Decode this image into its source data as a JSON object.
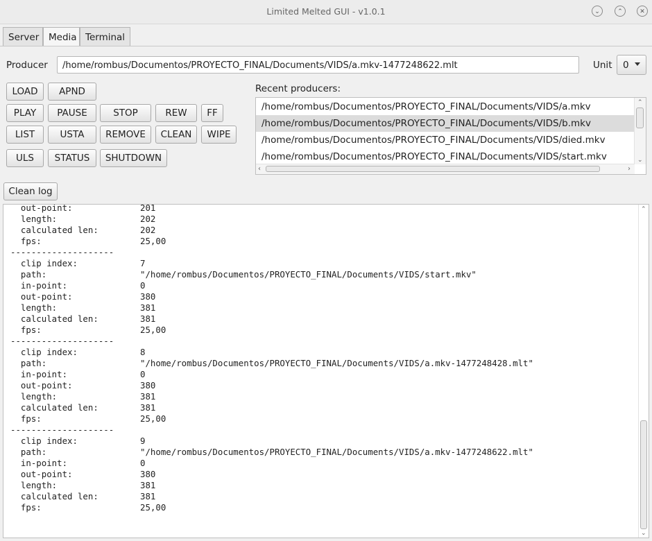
{
  "window": {
    "title": "Limited Melted GUI - v1.0.1"
  },
  "tabs": [
    {
      "label": "Server"
    },
    {
      "label": "Media"
    },
    {
      "label": "Terminal"
    }
  ],
  "producer": {
    "label": "Producer",
    "value": "/home/rombus/Documentos/PROYECTO_FINAL/Documents/VIDS/a.mkv-1477248622.mlt"
  },
  "unit": {
    "label": "Unit",
    "value": "0"
  },
  "buttons": {
    "load": "LOAD",
    "apnd": "APND",
    "play": "PLAY",
    "pause": "PAUSE",
    "stop": "STOP",
    "rew": "REW",
    "ff": "FF",
    "list": "LIST",
    "usta": "USTA",
    "remove": "REMOVE",
    "clean": "CLEAN",
    "wipe": "WIPE",
    "uls": "ULS",
    "status": "STATUS",
    "shutdown": "SHUTDOWN"
  },
  "recent": {
    "label": "Recent producers:",
    "items": [
      "/home/rombus/Documentos/PROYECTO_FINAL/Documents/VIDS/a.mkv",
      "/home/rombus/Documentos/PROYECTO_FINAL/Documents/VIDS/b.mkv",
      "/home/rombus/Documentos/PROYECTO_FINAL/Documents/VIDS/died.mkv",
      "/home/rombus/Documentos/PROYECTO_FINAL/Documents/VIDS/start.mkv"
    ],
    "selected_index": 1
  },
  "clean_log_label": "Clean log",
  "log": {
    "separator": "--------------------",
    "lines": [
      {
        "k": "  out-point:",
        "v": "201"
      },
      {
        "k": "  length:",
        "v": "202"
      },
      {
        "k": "  calculated len:",
        "v": "202"
      },
      {
        "k": "  fps:",
        "v": "25,00"
      },
      {
        "sep": true
      },
      {
        "k": "  clip index:",
        "v": "7"
      },
      {
        "k": "  path:",
        "v": "\"/home/rombus/Documentos/PROYECTO_FINAL/Documents/VIDS/start.mkv\""
      },
      {
        "k": "  in-point:",
        "v": "0"
      },
      {
        "k": "  out-point:",
        "v": "380"
      },
      {
        "k": "  length:",
        "v": "381"
      },
      {
        "k": "  calculated len:",
        "v": "381"
      },
      {
        "k": "  fps:",
        "v": "25,00"
      },
      {
        "sep": true
      },
      {
        "k": "  clip index:",
        "v": "8"
      },
      {
        "k": "  path:",
        "v": "\"/home/rombus/Documentos/PROYECTO_FINAL/Documents/VIDS/a.mkv-1477248428.mlt\""
      },
      {
        "k": "  in-point:",
        "v": "0"
      },
      {
        "k": "  out-point:",
        "v": "380"
      },
      {
        "k": "  length:",
        "v": "381"
      },
      {
        "k": "  calculated len:",
        "v": "381"
      },
      {
        "k": "  fps:",
        "v": "25,00"
      },
      {
        "sep": true
      },
      {
        "k": "  clip index:",
        "v": "9"
      },
      {
        "k": "  path:",
        "v": "\"/home/rombus/Documentos/PROYECTO_FINAL/Documents/VIDS/a.mkv-1477248622.mlt\""
      },
      {
        "k": "  in-point:",
        "v": "0"
      },
      {
        "k": "  out-point:",
        "v": "380"
      },
      {
        "k": "  length:",
        "v": "381"
      },
      {
        "k": "  calculated len:",
        "v": "381"
      },
      {
        "k": "  fps:",
        "v": "25,00"
      }
    ]
  }
}
